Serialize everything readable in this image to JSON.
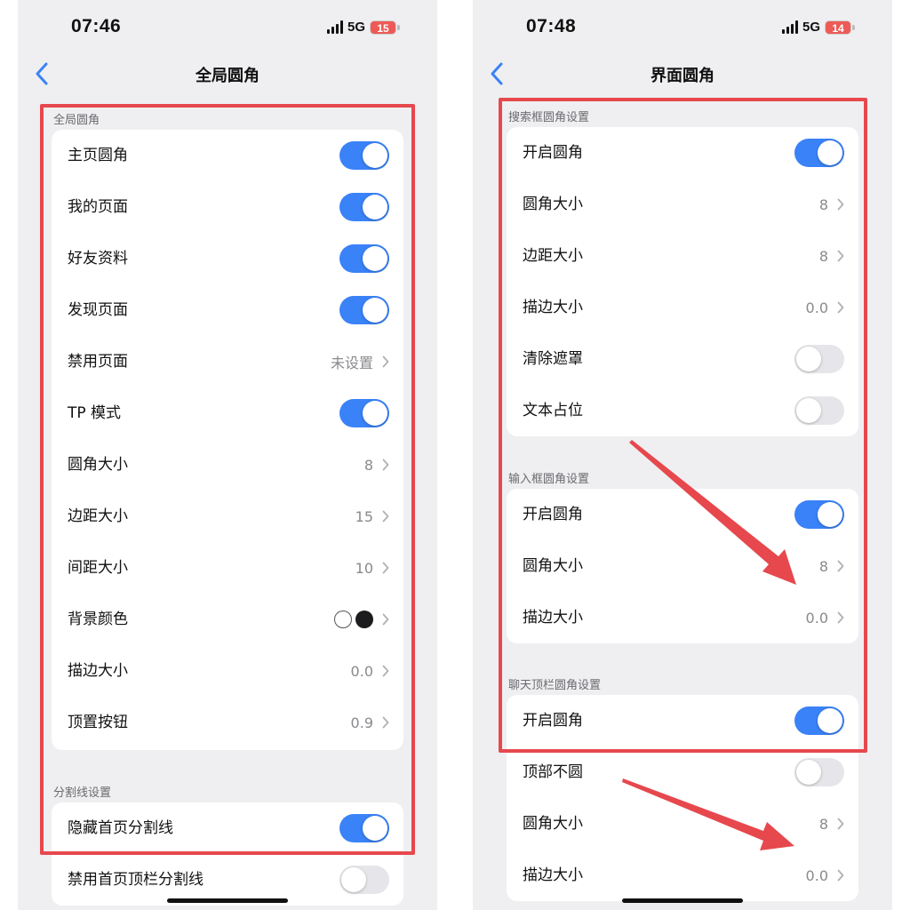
{
  "left": {
    "status": {
      "time": "07:46",
      "network": "5G",
      "battery": "15"
    },
    "nav": {
      "title": "全局圆角"
    },
    "sections": [
      {
        "header": "全局圆角",
        "rows": [
          {
            "label": "主页圆角",
            "type": "toggle",
            "on": true
          },
          {
            "label": "我的页面",
            "type": "toggle",
            "on": true
          },
          {
            "label": "好友资料",
            "type": "toggle",
            "on": true
          },
          {
            "label": "发现页面",
            "type": "toggle",
            "on": true
          },
          {
            "label": "禁用页面",
            "type": "value",
            "value": "未设置"
          },
          {
            "label": "TP 模式",
            "type": "toggle",
            "on": true
          },
          {
            "label": "圆角大小",
            "type": "value",
            "value": "8"
          },
          {
            "label": "边距大小",
            "type": "value",
            "value": "15"
          },
          {
            "label": "间距大小",
            "type": "value",
            "value": "10"
          },
          {
            "label": "背景颜色",
            "type": "colors",
            "colors": [
              "#ffffff",
              "#1c1c1e"
            ]
          },
          {
            "label": "描边大小",
            "type": "value",
            "value": "0.0"
          },
          {
            "label": "顶置按钮",
            "type": "value",
            "value": "0.9"
          }
        ]
      },
      {
        "header": "分割线设置",
        "rows": [
          {
            "label": "隐藏首页分割线",
            "type": "toggle",
            "on": true
          },
          {
            "label": "禁用首页顶栏分割线",
            "type": "toggle",
            "on": false
          }
        ]
      }
    ]
  },
  "right": {
    "status": {
      "time": "07:48",
      "network": "5G",
      "battery": "14"
    },
    "nav": {
      "title": "界面圆角"
    },
    "sections": [
      {
        "header": "搜索框圆角设置",
        "rows": [
          {
            "label": "开启圆角",
            "type": "toggle",
            "on": true
          },
          {
            "label": "圆角大小",
            "type": "value",
            "value": "8"
          },
          {
            "label": "边距大小",
            "type": "value",
            "value": "8"
          },
          {
            "label": "描边大小",
            "type": "value",
            "value": "0.0"
          },
          {
            "label": "清除遮罩",
            "type": "toggle",
            "on": false
          },
          {
            "label": "文本占位",
            "type": "toggle",
            "on": false
          }
        ]
      },
      {
        "header": "输入框圆角设置",
        "rows": [
          {
            "label": "开启圆角",
            "type": "toggle",
            "on": true
          },
          {
            "label": "圆角大小",
            "type": "value",
            "value": "8"
          },
          {
            "label": "描边大小",
            "type": "value",
            "value": "0.0"
          }
        ]
      },
      {
        "header": "聊天顶栏圆角设置",
        "rows": [
          {
            "label": "开启圆角",
            "type": "toggle",
            "on": true
          },
          {
            "label": "顶部不圆",
            "type": "toggle",
            "on": false
          },
          {
            "label": "圆角大小",
            "type": "value",
            "value": "8"
          },
          {
            "label": "描边大小",
            "type": "value",
            "value": "0.0"
          }
        ]
      }
    ]
  },
  "colors": {
    "accent": "#3a82f7",
    "toggle_off": "#e6e6ea",
    "annotation": "#e6484d",
    "background": "#efeff1",
    "card": "#ffffff"
  },
  "icons": {
    "back": "chevron-left-icon",
    "row_arrow": "chevron-right-icon"
  }
}
